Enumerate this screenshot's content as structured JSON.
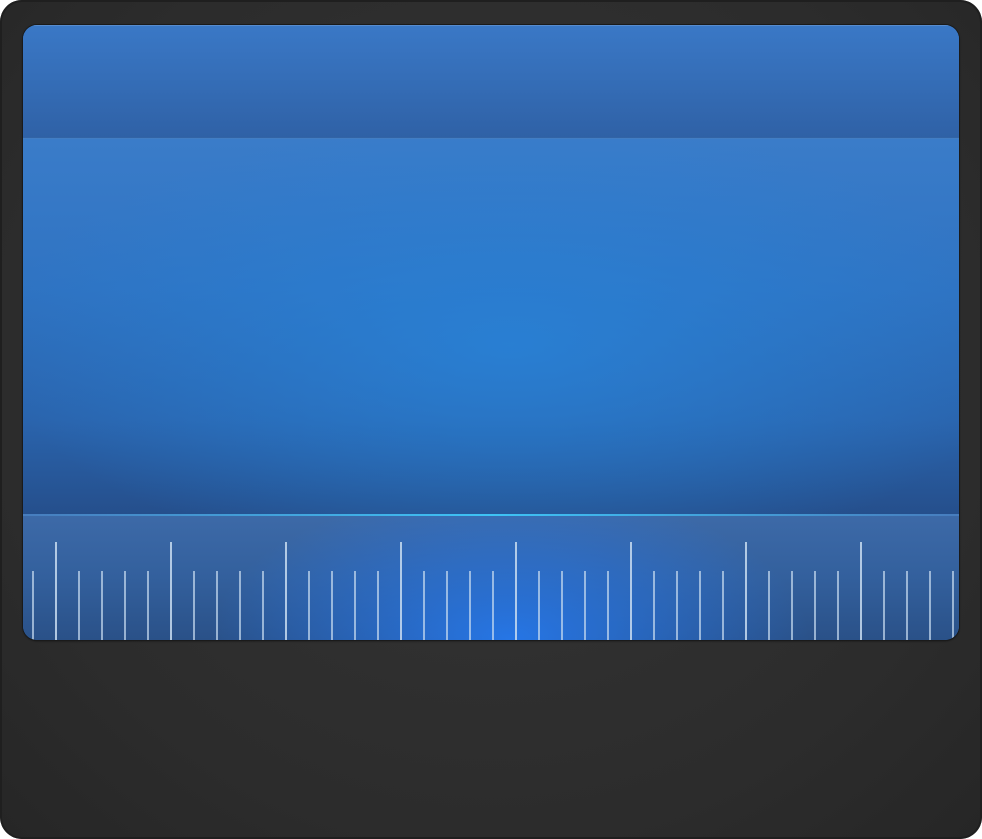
{
  "app": {
    "header_text": "",
    "display_text": ""
  },
  "ruler": {
    "tick_count": 41,
    "major_every": 5
  },
  "colors": {
    "frame": "#2e2e2e",
    "screen_blue": "#2a6ab8",
    "ruler_highlight": "#3ec3f5",
    "tick": "#c8dcf0"
  }
}
